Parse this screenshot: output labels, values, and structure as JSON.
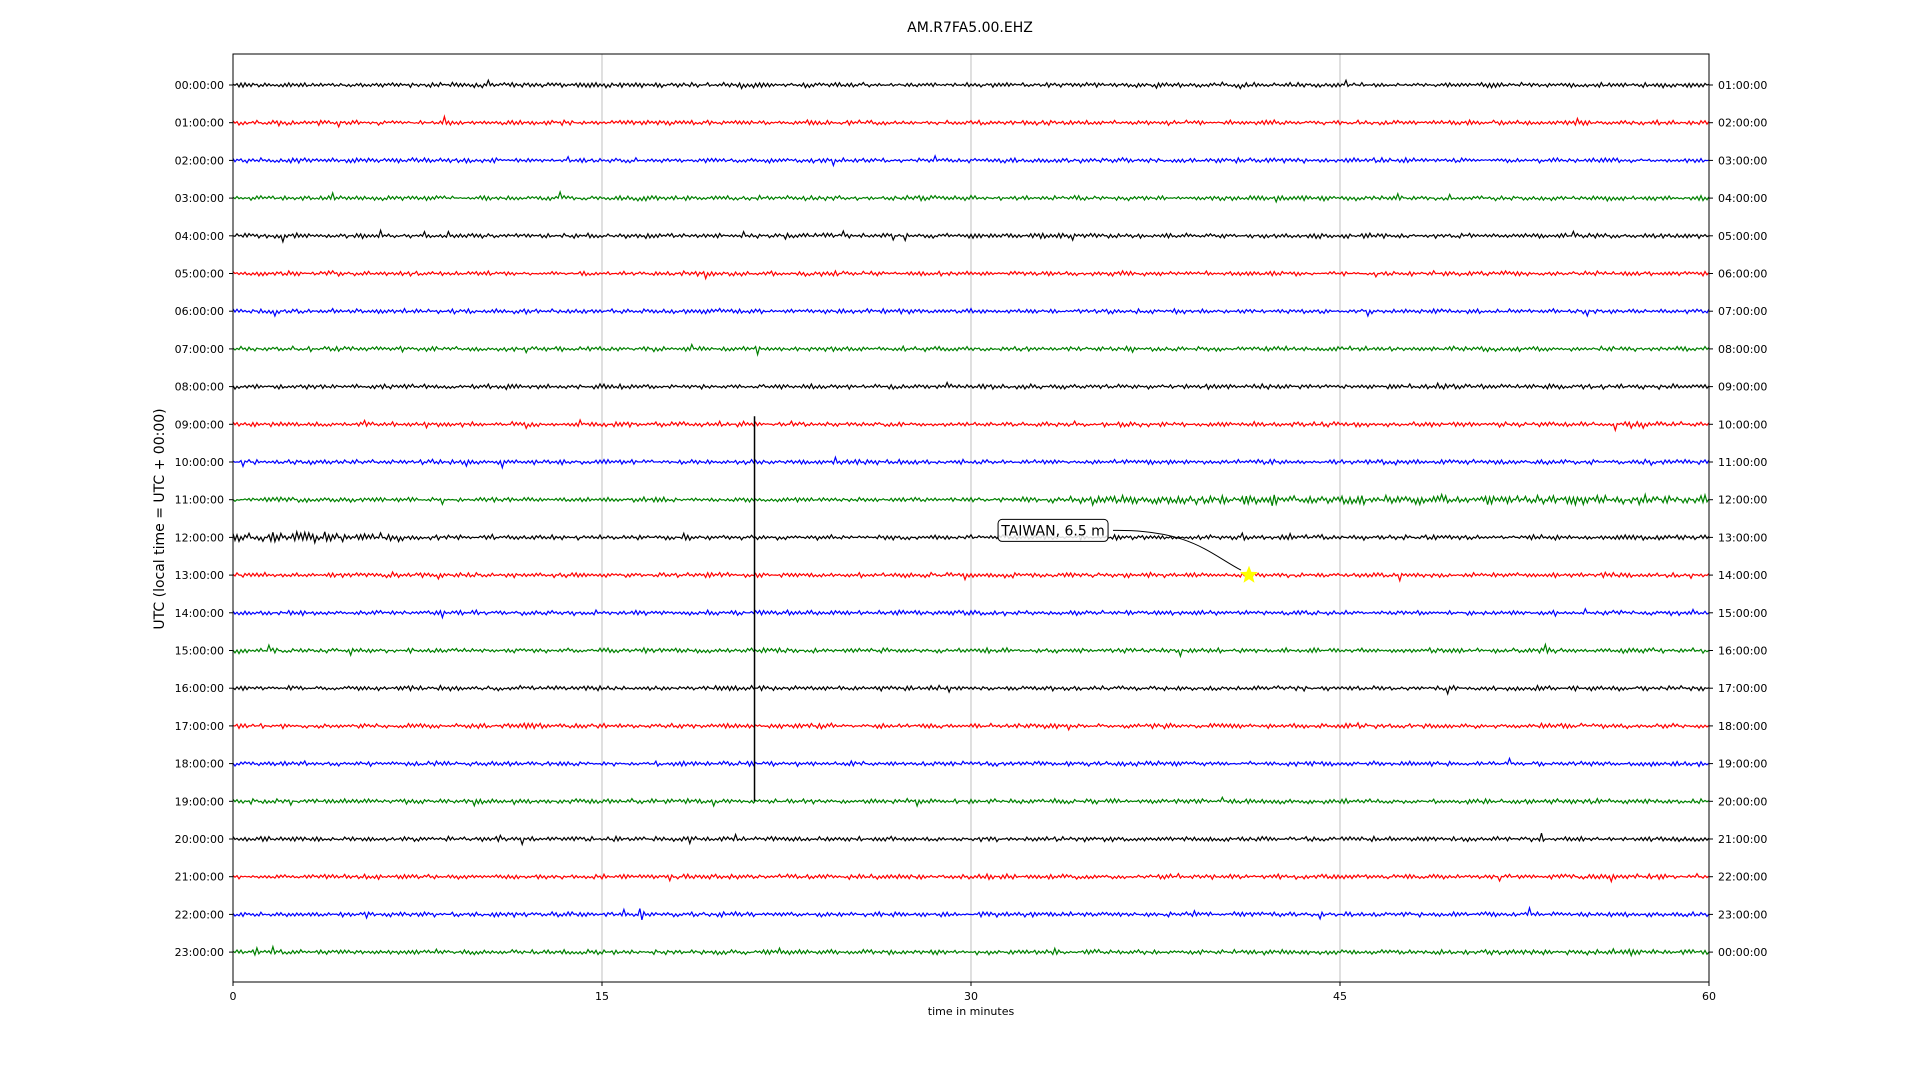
{
  "chart_data": {
    "type": "line",
    "title": "AM.R7FA5.00.EHZ",
    "xlabel": "time in minutes",
    "ylabel": "UTC (local time = UTC + 00:00)",
    "xlim": [
      0,
      60
    ],
    "x_ticks": [
      "0",
      "15",
      "30",
      "45",
      "60"
    ],
    "x_tick_values": [
      0,
      15,
      30,
      45,
      60
    ],
    "grid": "vertical",
    "colors": [
      "#000000",
      "#ff0000",
      "#0000ff",
      "#008000"
    ],
    "left_labels": [
      "00:00:00",
      "01:00:00",
      "02:00:00",
      "03:00:00",
      "04:00:00",
      "05:00:00",
      "06:00:00",
      "07:00:00",
      "08:00:00",
      "09:00:00",
      "10:00:00",
      "11:00:00",
      "12:00:00",
      "13:00:00",
      "14:00:00",
      "15:00:00",
      "16:00:00",
      "17:00:00",
      "18:00:00",
      "19:00:00",
      "20:00:00",
      "21:00:00",
      "22:00:00",
      "23:00:00"
    ],
    "right_labels": [
      "01:00:00",
      "02:00:00",
      "03:00:00",
      "04:00:00",
      "05:00:00",
      "06:00:00",
      "07:00:00",
      "08:00:00",
      "09:00:00",
      "10:00:00",
      "11:00:00",
      "12:00:00",
      "13:00:00",
      "14:00:00",
      "15:00:00",
      "16:00:00",
      "17:00:00",
      "18:00:00",
      "19:00:00",
      "20:00:00",
      "21:00:00",
      "22:00:00",
      "23:00:00",
      "00:00:00"
    ],
    "event": {
      "label": "TAIWAN, 6.5 m",
      "hour_row": 13,
      "minute": 41.3,
      "marker_color": "#ffff00"
    },
    "spike": {
      "minute": 21.2,
      "from_row": 9,
      "to_row": 19
    }
  }
}
